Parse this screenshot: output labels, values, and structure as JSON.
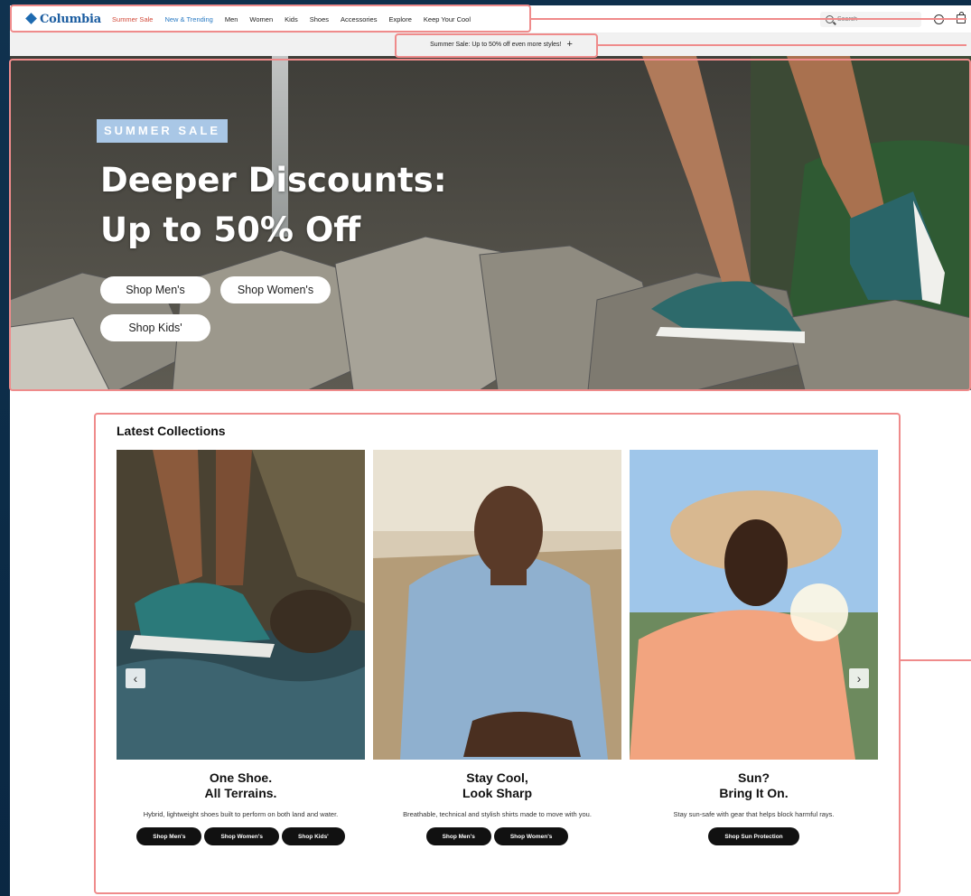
{
  "brand": {
    "name": "Columbia"
  },
  "nav": {
    "links": [
      "Summer Sale",
      "New & Trending",
      "Men",
      "Women",
      "Kids",
      "Shoes",
      "Accessories",
      "Explore",
      "Keep Your Cool"
    ],
    "search_placeholder": "Search"
  },
  "promo": {
    "text": "Summer Sale: Up to 50% off even more styles!",
    "expand": "+"
  },
  "hero": {
    "badge": "SUMMER SALE",
    "title_line1": "Deeper Discounts:",
    "title_line2": "Up to 50% Off",
    "buttons": [
      "Shop Men's",
      "Shop Women's",
      "Shop Kids'"
    ]
  },
  "collections": {
    "title": "Latest Collections",
    "prev": "‹",
    "next": "›",
    "cards": [
      {
        "heading_line1": "One Shoe.",
        "heading_line2": "All Terrains.",
        "text": "Hybrid, lightweight shoes built to perform on both land and water.",
        "buttons": [
          "Shop Men's",
          "Shop Women's",
          "Shop Kids'"
        ]
      },
      {
        "heading_line1": "Stay Cool,",
        "heading_line2": "Look Sharp",
        "text": "Breathable, technical and stylish shirts made to move with you.",
        "buttons": [
          "Shop Men's",
          "Shop Women's"
        ]
      },
      {
        "heading_line1": "Sun?",
        "heading_line2": "Bring It On.",
        "text": "Stay sun-safe with gear that helps block harmful rays.",
        "buttons": [
          "Shop Sun Protection"
        ]
      }
    ]
  },
  "colors": {
    "sale": "#d24a3a",
    "trend": "#2a7bc4",
    "brand": "#1a5ca0",
    "badge": "#a9c7e6",
    "annotation": "#ef8b8b"
  }
}
